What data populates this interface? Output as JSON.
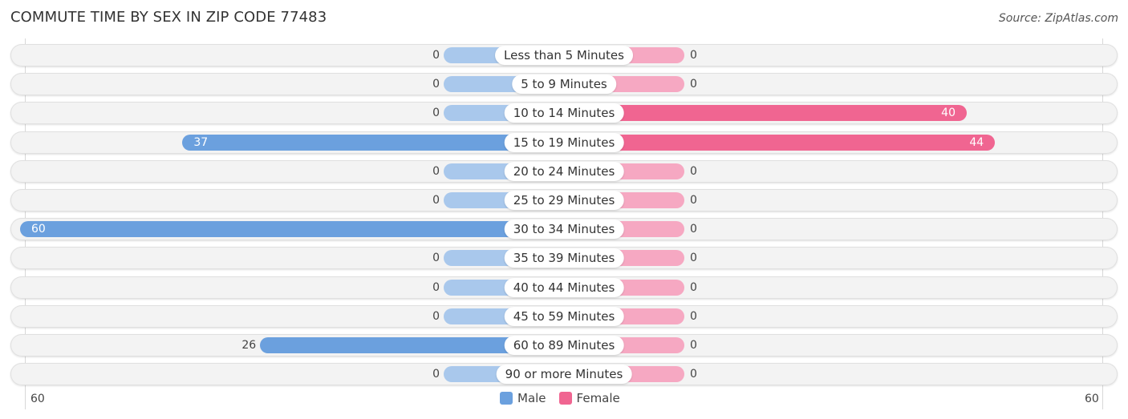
{
  "title": "COMMUTE TIME BY SEX IN ZIP CODE 77483",
  "source": "Source: ZipAtlas.com",
  "colors": {
    "male": "#6ba0de",
    "male_light": "#a9c8ec",
    "female": "#f06591",
    "female_light": "#f6a8c2"
  },
  "chart_data": {
    "type": "bar",
    "orientation": "horizontal-diverging",
    "title": "COMMUTE TIME BY SEX IN ZIP CODE 77483",
    "categories": [
      "Less than 5 Minutes",
      "5 to 9 Minutes",
      "10 to 14 Minutes",
      "15 to 19 Minutes",
      "20 to 24 Minutes",
      "25 to 29 Minutes",
      "30 to 34 Minutes",
      "35 to 39 Minutes",
      "40 to 44 Minutes",
      "45 to 59 Minutes",
      "60 to 89 Minutes",
      "90 or more Minutes"
    ],
    "series": [
      {
        "name": "Male",
        "values": [
          0,
          0,
          0,
          37,
          0,
          0,
          60,
          0,
          0,
          0,
          26,
          0
        ]
      },
      {
        "name": "Female",
        "values": [
          0,
          0,
          40,
          44,
          0,
          0,
          0,
          0,
          0,
          0,
          0,
          0
        ]
      }
    ],
    "axis": {
      "left_label": "60",
      "right_label": "60",
      "max": 60
    },
    "legend": {
      "position": "bottom-center",
      "entries": [
        "Male",
        "Female"
      ]
    }
  }
}
